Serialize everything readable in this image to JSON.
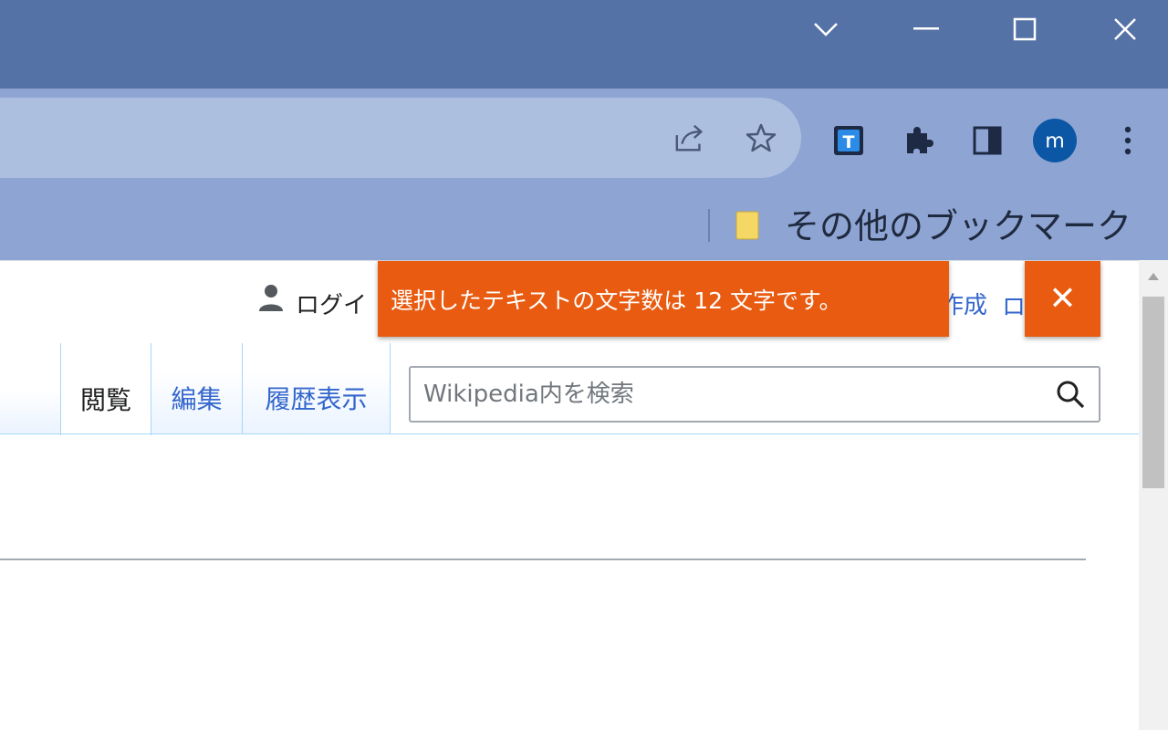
{
  "window": {
    "controls": [
      "tab-search",
      "minimize",
      "maximize",
      "close"
    ]
  },
  "toolbar": {
    "extension_badge": "T",
    "profile_initial": "m"
  },
  "bookmarks_bar": {
    "other_bookmarks": "その他のブックマーク"
  },
  "page": {
    "login_label": "ログイ",
    "create_label": "作成",
    "create2_label": "ロ",
    "toast": {
      "message": "選択したテキストの文字数は 12 文字です。",
      "close_glyph": "✕",
      "color": "#e85b10"
    },
    "tabs": [
      {
        "label": "閲覧",
        "selected": true
      },
      {
        "label": "編集",
        "selected": false
      },
      {
        "label": "履歴表示",
        "selected": false
      }
    ],
    "search": {
      "placeholder": "Wikipedia内を検索",
      "value": ""
    }
  },
  "colors": {
    "titlebar": "#5572a6",
    "toolbar": "#8ea5d4",
    "link": "#3366cc"
  }
}
